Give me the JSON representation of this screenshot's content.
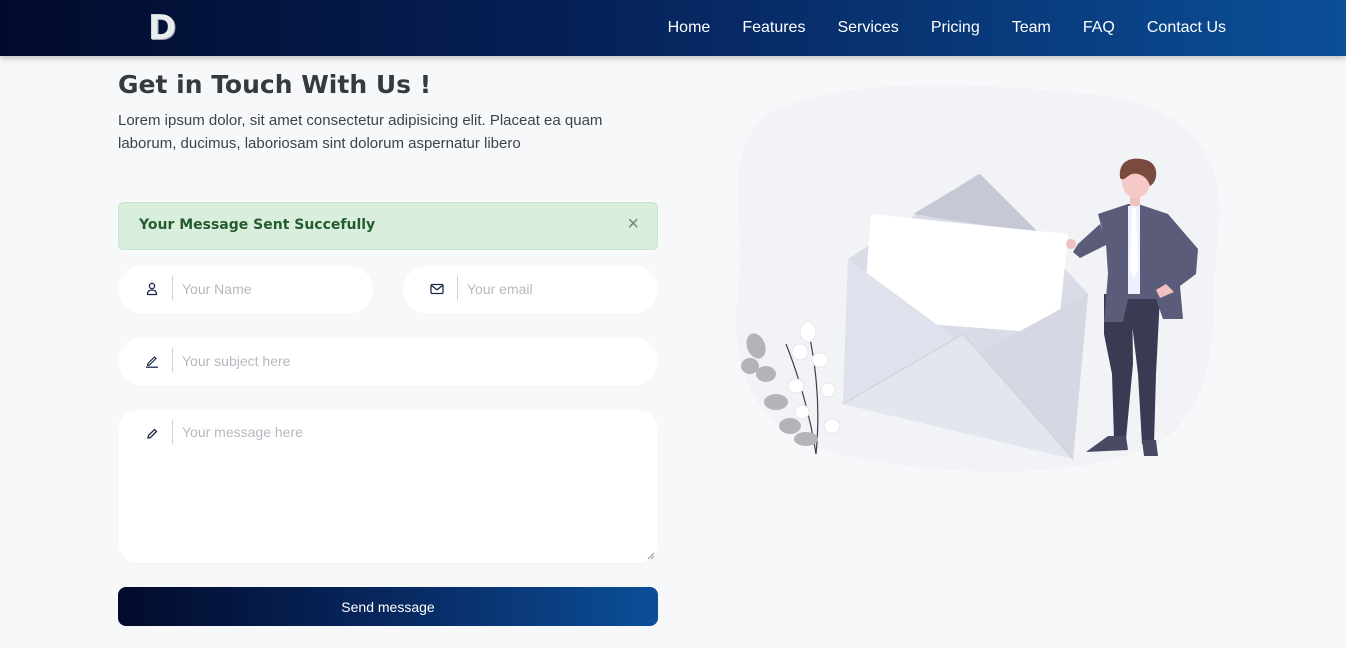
{
  "brand": {
    "logo_text": "D"
  },
  "nav": {
    "items": [
      {
        "label": "Home"
      },
      {
        "label": "Features"
      },
      {
        "label": "Services"
      },
      {
        "label": "Pricing"
      },
      {
        "label": "Team"
      },
      {
        "label": "FAQ"
      },
      {
        "label": "Contact Us"
      }
    ]
  },
  "contact": {
    "title": "Get in Touch With Us !",
    "description": "Lorem ipsum dolor, sit amet consectetur adipisicing elit. Placeat ea quam laborum, ducimus, laboriosam sint dolorum aspernatur libero",
    "alert": {
      "text": "Your Message Sent Succefully",
      "close_symbol": "×"
    },
    "name_field": {
      "placeholder": "Your Name",
      "value": "",
      "icon": "user-icon"
    },
    "email_field": {
      "placeholder": "Your email",
      "value": "",
      "icon": "envelope-icon"
    },
    "subject_field": {
      "placeholder": "Your subject here",
      "value": "",
      "icon": "pencil-underline-icon"
    },
    "message_field": {
      "placeholder": "Your message here",
      "value": "",
      "icon": "pencil-icon"
    },
    "submit_label": "Send message"
  },
  "colors": {
    "nav_gradient_start": "#020b2b",
    "nav_gradient_end": "#0b4f98",
    "alert_bg": "#d9eedc",
    "alert_text": "#245b2f",
    "page_bg": "#f6f8fa"
  }
}
